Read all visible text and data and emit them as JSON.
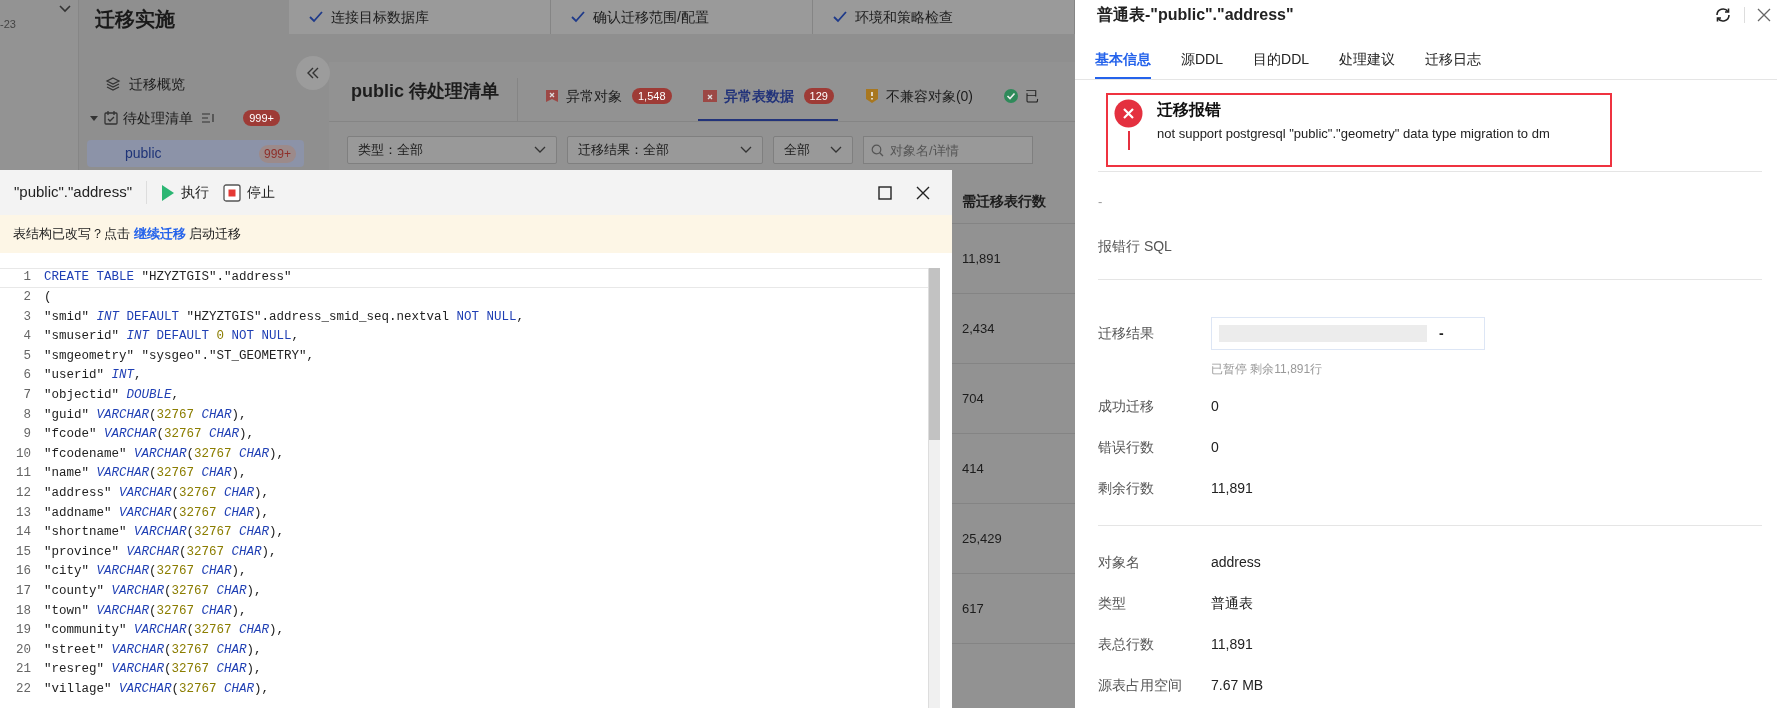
{
  "app": {
    "strip_date": "-23",
    "title": "迁移实施",
    "steps": [
      {
        "label": "连接目标数据库",
        "done": true
      },
      {
        "label": "确认迁移范围/配置",
        "done": true
      },
      {
        "label": "环境和策略检查",
        "done": true
      }
    ],
    "nav": [
      {
        "label": "迁移概览",
        "kind": "overview",
        "selected": false
      },
      {
        "label": "待处理清单",
        "kind": "group",
        "badge": "999+",
        "selected": false,
        "expanded": true,
        "children": [
          {
            "label": "public",
            "badge": "999+",
            "selected": true
          }
        ]
      }
    ]
  },
  "panel": {
    "title": "public 待处理清单",
    "tabs": [
      {
        "label": "异常对象",
        "count": "1,548",
        "kind": "error",
        "selected": false
      },
      {
        "label": "异常表数据",
        "count": "129",
        "kind": "table",
        "selected": true
      },
      {
        "label": "不兼容对象(0)",
        "kind": "warning",
        "selected": false
      },
      {
        "label": "已",
        "kind": "ok",
        "selected": false
      }
    ],
    "filters": [
      {
        "label": "类型：全部"
      },
      {
        "label": "迁移结果：全部"
      },
      {
        "label": "全部"
      }
    ],
    "search": {
      "placeholder": "对象名/详情"
    },
    "table": {
      "columns": [
        "需迁移表行数"
      ],
      "rows": [
        [
          "11,891"
        ],
        [
          "2,434"
        ],
        [
          "704"
        ],
        [
          "414"
        ],
        [
          "25,429"
        ],
        [
          "617"
        ]
      ]
    }
  },
  "editor_dialog": {
    "title": "\"public\".\"address\"",
    "actions": [
      {
        "label": "执行",
        "kind": "run"
      },
      {
        "label": "停止",
        "kind": "stop"
      }
    ],
    "notice": "表结构已改写？点击 ",
    "notice_link": "继续迁移",
    "notice_end": " 启动迁移",
    "lines": [
      {
        "number": "1",
        "tokens": [
          {
            "kind": "keyword",
            "text": "CREATE TABLE"
          },
          {
            "kind": "plain",
            "text": " \"HZYZTGIS\".\"address\""
          }
        ]
      },
      {
        "number": "2",
        "tokens": [
          {
            "kind": "plain",
            "text": "("
          }
        ]
      },
      {
        "number": "3",
        "tokens": [
          {
            "kind": "plain",
            "text": "\"smid\" "
          },
          {
            "kind": "type",
            "text": "INT"
          },
          {
            "kind": "keyword",
            "text": " DEFAULT"
          },
          {
            "kind": "plain",
            "text": " \"HZYZTGIS\".address_smid_seq.nextval "
          },
          {
            "kind": "keyword",
            "text": "NOT NULL"
          },
          {
            "kind": "plain",
            "text": ","
          }
        ]
      },
      {
        "number": "4",
        "tokens": [
          {
            "kind": "plain",
            "text": "\"smuserid\" "
          },
          {
            "kind": "type",
            "text": "INT"
          },
          {
            "kind": "keyword",
            "text": " DEFAULT "
          },
          {
            "kind": "number",
            "text": "0"
          },
          {
            "kind": "keyword",
            "text": " NOT NULL"
          },
          {
            "kind": "plain",
            "text": ","
          }
        ]
      },
      {
        "number": "5",
        "tokens": [
          {
            "kind": "plain",
            "text": "\"smgeometry\" \"sysgeo\".\"ST_GEOMETRY\","
          }
        ]
      },
      {
        "number": "6",
        "tokens": [
          {
            "kind": "plain",
            "text": "\"userid\" "
          },
          {
            "kind": "type",
            "text": "INT"
          },
          {
            "kind": "plain",
            "text": ","
          }
        ]
      },
      {
        "number": "7",
        "tokens": [
          {
            "kind": "plain",
            "text": "\"objectid\" "
          },
          {
            "kind": "type",
            "text": "DOUBLE"
          },
          {
            "kind": "plain",
            "text": ","
          }
        ]
      },
      {
        "number": "8",
        "tokens": [
          {
            "kind": "plain",
            "text": "\"guid\" "
          },
          {
            "kind": "type",
            "text": "VARCHAR"
          },
          {
            "kind": "plain",
            "text": "("
          },
          {
            "kind": "number",
            "text": "32767"
          },
          {
            "kind": "type",
            "text": " CHAR"
          },
          {
            "kind": "plain",
            "text": "),"
          }
        ]
      },
      {
        "number": "9",
        "tokens": [
          {
            "kind": "plain",
            "text": "\"fcode\" "
          },
          {
            "kind": "type",
            "text": "VARCHAR"
          },
          {
            "kind": "plain",
            "text": "("
          },
          {
            "kind": "number",
            "text": "32767"
          },
          {
            "kind": "type",
            "text": " CHAR"
          },
          {
            "kind": "plain",
            "text": "),"
          }
        ]
      },
      {
        "number": "10",
        "tokens": [
          {
            "kind": "plain",
            "text": "\"fcodename\" "
          },
          {
            "kind": "type",
            "text": "VARCHAR"
          },
          {
            "kind": "plain",
            "text": "("
          },
          {
            "kind": "number",
            "text": "32767"
          },
          {
            "kind": "type",
            "text": " CHAR"
          },
          {
            "kind": "plain",
            "text": "),"
          }
        ]
      },
      {
        "number": "11",
        "tokens": [
          {
            "kind": "plain",
            "text": "\"name\" "
          },
          {
            "kind": "type",
            "text": "VARCHAR"
          },
          {
            "kind": "plain",
            "text": "("
          },
          {
            "kind": "number",
            "text": "32767"
          },
          {
            "kind": "type",
            "text": " CHAR"
          },
          {
            "kind": "plain",
            "text": "),"
          }
        ]
      },
      {
        "number": "12",
        "tokens": [
          {
            "kind": "plain",
            "text": "\"address\" "
          },
          {
            "kind": "type",
            "text": "VARCHAR"
          },
          {
            "kind": "plain",
            "text": "("
          },
          {
            "kind": "number",
            "text": "32767"
          },
          {
            "kind": "type",
            "text": " CHAR"
          },
          {
            "kind": "plain",
            "text": "),"
          }
        ]
      },
      {
        "number": "13",
        "tokens": [
          {
            "kind": "plain",
            "text": "\"addname\" "
          },
          {
            "kind": "type",
            "text": "VARCHAR"
          },
          {
            "kind": "plain",
            "text": "("
          },
          {
            "kind": "number",
            "text": "32767"
          },
          {
            "kind": "type",
            "text": " CHAR"
          },
          {
            "kind": "plain",
            "text": "),"
          }
        ]
      },
      {
        "number": "14",
        "tokens": [
          {
            "kind": "plain",
            "text": "\"shortname\" "
          },
          {
            "kind": "type",
            "text": "VARCHAR"
          },
          {
            "kind": "plain",
            "text": "("
          },
          {
            "kind": "number",
            "text": "32767"
          },
          {
            "kind": "type",
            "text": " CHAR"
          },
          {
            "kind": "plain",
            "text": "),"
          }
        ]
      },
      {
        "number": "15",
        "tokens": [
          {
            "kind": "plain",
            "text": "\"province\" "
          },
          {
            "kind": "type",
            "text": "VARCHAR"
          },
          {
            "kind": "plain",
            "text": "("
          },
          {
            "kind": "number",
            "text": "32767"
          },
          {
            "kind": "type",
            "text": " CHAR"
          },
          {
            "kind": "plain",
            "text": "),"
          }
        ]
      },
      {
        "number": "16",
        "tokens": [
          {
            "kind": "plain",
            "text": "\"city\" "
          },
          {
            "kind": "type",
            "text": "VARCHAR"
          },
          {
            "kind": "plain",
            "text": "("
          },
          {
            "kind": "number",
            "text": "32767"
          },
          {
            "kind": "type",
            "text": " CHAR"
          },
          {
            "kind": "plain",
            "text": "),"
          }
        ]
      },
      {
        "number": "17",
        "tokens": [
          {
            "kind": "plain",
            "text": "\"county\" "
          },
          {
            "kind": "type",
            "text": "VARCHAR"
          },
          {
            "kind": "plain",
            "text": "("
          },
          {
            "kind": "number",
            "text": "32767"
          },
          {
            "kind": "type",
            "text": " CHAR"
          },
          {
            "kind": "plain",
            "text": "),"
          }
        ]
      },
      {
        "number": "18",
        "tokens": [
          {
            "kind": "plain",
            "text": "\"town\" "
          },
          {
            "kind": "type",
            "text": "VARCHAR"
          },
          {
            "kind": "plain",
            "text": "("
          },
          {
            "kind": "number",
            "text": "32767"
          },
          {
            "kind": "type",
            "text": " CHAR"
          },
          {
            "kind": "plain",
            "text": "),"
          }
        ]
      },
      {
        "number": "19",
        "tokens": [
          {
            "kind": "plain",
            "text": "\"community\" "
          },
          {
            "kind": "type",
            "text": "VARCHAR"
          },
          {
            "kind": "plain",
            "text": "("
          },
          {
            "kind": "number",
            "text": "32767"
          },
          {
            "kind": "type",
            "text": " CHAR"
          },
          {
            "kind": "plain",
            "text": "),"
          }
        ]
      },
      {
        "number": "20",
        "tokens": [
          {
            "kind": "plain",
            "text": "\"street\" "
          },
          {
            "kind": "type",
            "text": "VARCHAR"
          },
          {
            "kind": "plain",
            "text": "("
          },
          {
            "kind": "number",
            "text": "32767"
          },
          {
            "kind": "type",
            "text": " CHAR"
          },
          {
            "kind": "plain",
            "text": "),"
          }
        ]
      },
      {
        "number": "21",
        "tokens": [
          {
            "kind": "plain",
            "text": "\"resreg\" "
          },
          {
            "kind": "type",
            "text": "VARCHAR"
          },
          {
            "kind": "plain",
            "text": "("
          },
          {
            "kind": "number",
            "text": "32767"
          },
          {
            "kind": "type",
            "text": " CHAR"
          },
          {
            "kind": "plain",
            "text": "),"
          }
        ]
      },
      {
        "number": "22",
        "tokens": [
          {
            "kind": "plain",
            "text": "\"village\" "
          },
          {
            "kind": "type",
            "text": "VARCHAR"
          },
          {
            "kind": "plain",
            "text": "("
          },
          {
            "kind": "number",
            "text": "32767"
          },
          {
            "kind": "type",
            "text": " CHAR"
          },
          {
            "kind": "plain",
            "text": "),"
          }
        ]
      }
    ]
  },
  "drawer": {
    "title": "普通表-\"public\".\"address\"",
    "tabs": [
      {
        "label": "基本信息",
        "selected": true
      },
      {
        "label": "源DDL",
        "selected": false
      },
      {
        "label": "目的DDL",
        "selected": false
      },
      {
        "label": "处理建议",
        "selected": false
      },
      {
        "label": "迁移日志",
        "selected": false
      }
    ],
    "error": {
      "title": "迁移报错",
      "message": "not support postgresql \"public\".\"geometry\" data type migration to dm"
    },
    "error_detail": "-",
    "error_sql_label": "报错行 SQL",
    "result": {
      "label": "迁移结果",
      "level": 0,
      "reading": "-",
      "note": "已暂停 剩余11,891行"
    },
    "stats": [
      {
        "label": "成功迁移",
        "value": "0"
      },
      {
        "label": "错误行数",
        "value": "0"
      },
      {
        "label": "剩余行数",
        "value": "11,891"
      }
    ],
    "info": [
      {
        "label": "对象名",
        "value": "address"
      },
      {
        "label": "类型",
        "value": "普通表"
      },
      {
        "label": "表总行数",
        "value": "11,891"
      },
      {
        "label": "源表占用空间",
        "value": "7.67 MB"
      }
    ]
  }
}
